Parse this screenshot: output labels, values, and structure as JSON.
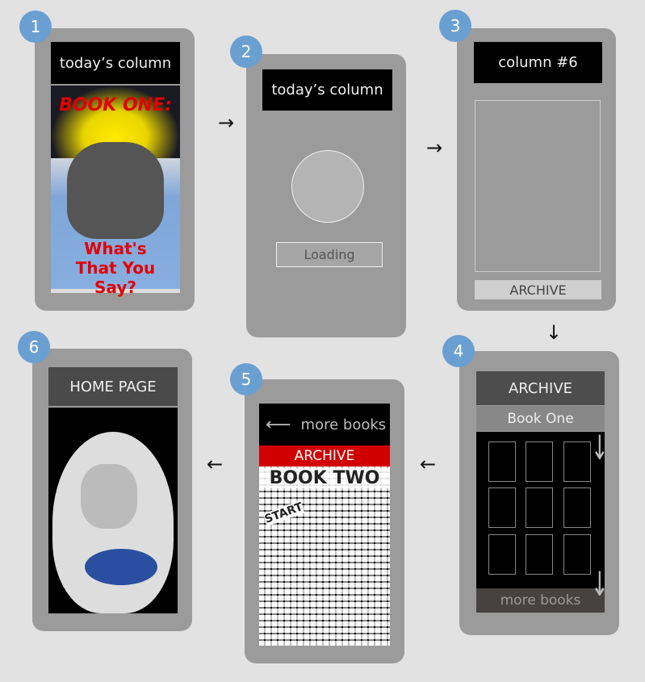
{
  "steps": [
    "1",
    "2",
    "3",
    "4",
    "5",
    "6"
  ],
  "screen1": {
    "header": "today’s column",
    "cover_title": "BOOK ONE:",
    "cover_subtitle": "What's That You Say?"
  },
  "screen2": {
    "header": "today’s column",
    "loading": "Loading"
  },
  "screen3": {
    "header": "column #6",
    "archive_button": "ARCHIVE"
  },
  "screen4": {
    "header": "ARCHIVE",
    "book": "Book One",
    "more": "more books"
  },
  "screen5": {
    "header": "more books",
    "back_icon": "left-arrow",
    "archive": "ARCHIVE",
    "cover_title": "BOOK TWO",
    "cover_start": "START"
  },
  "screen6": {
    "header": "HOME PAGE"
  },
  "arrows": {
    "a1": "→",
    "a2": "→",
    "a3": "↓",
    "a4": "←",
    "a5": "←",
    "scroll": "↓"
  },
  "colors": {
    "badge": "#6a9fd2",
    "phone": "#9b9b9b",
    "archive_red": "#d00000"
  }
}
